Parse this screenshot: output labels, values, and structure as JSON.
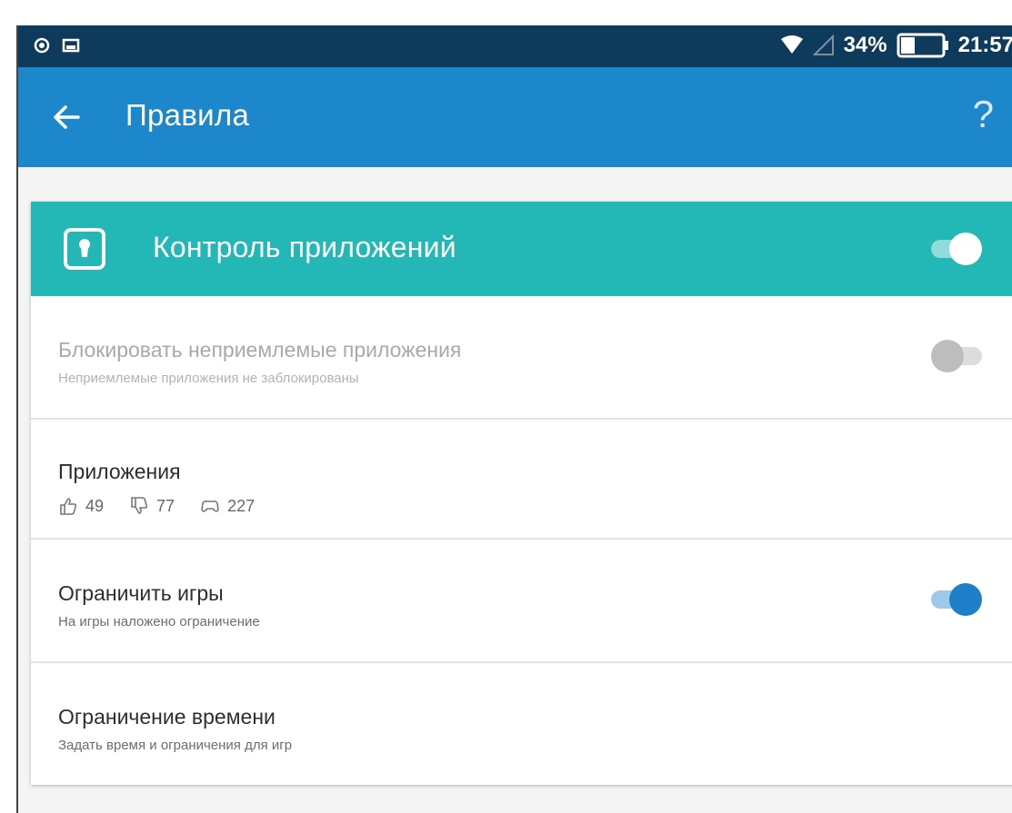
{
  "status_bar": {
    "battery": "34%",
    "time": "21:57",
    "icons": [
      "notification-icon",
      "image-icon",
      "wifi-icon",
      "signal-icon",
      "battery-icon"
    ]
  },
  "app_bar": {
    "title": "Правила",
    "help_label": "?"
  },
  "card": {
    "title": "Контроль приложений",
    "enabled": true,
    "colors": {
      "header": "#23b7b6",
      "accent": "#1d87cc"
    }
  },
  "rows": [
    {
      "title": "Блокировать неприемлемые приложения",
      "subtitle": "Неприемлемые приложения не заблокированы",
      "toggle": false,
      "disabled": true
    },
    {
      "title": "Приложения",
      "counts": {
        "allowed": "49",
        "blocked": "77",
        "restricted": "227"
      }
    },
    {
      "title": "Ограничить игры",
      "subtitle": "На игры наложено ограничение",
      "toggle": true
    },
    {
      "title": "Ограничение времени",
      "subtitle": "Задать время и ограничения для игр"
    }
  ]
}
